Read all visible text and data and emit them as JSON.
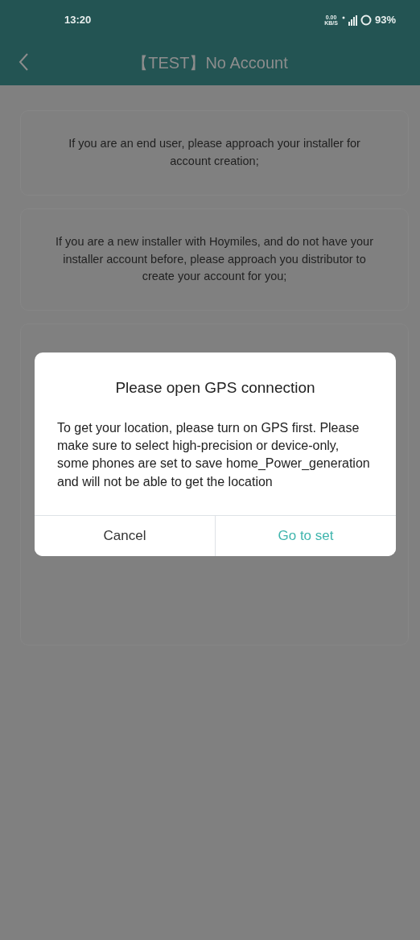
{
  "status_bar": {
    "time": "13:20",
    "net_speed": "0.00",
    "net_unit": "KB/S",
    "battery": "93%"
  },
  "header": {
    "title": "【TEST】No Account"
  },
  "cards": [
    {
      "text": "If you are an end user, please approach your installer for account creation;"
    },
    {
      "text": "If you are a new installer with Hoymiles, and do not have your installer account before, please approach you distributor to create your account for you;"
    }
  ],
  "dialog": {
    "title": "Please open GPS connection",
    "message": "To get your location, please turn on GPS first. Please make sure to select high-precision or device-only, some phones are set to save home_Power_generation and will not be able to get the location",
    "buttons": [
      {
        "label": "Cancel",
        "kind": "secondary"
      },
      {
        "label": "Go to set",
        "kind": "primary"
      }
    ]
  }
}
